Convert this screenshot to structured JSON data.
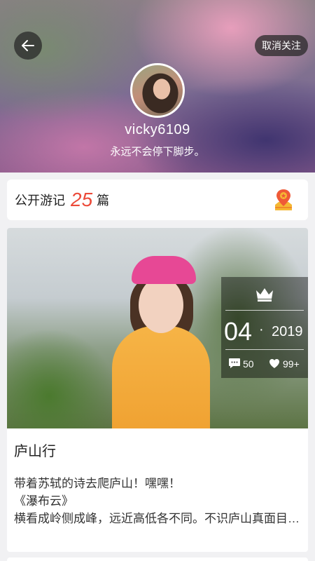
{
  "header": {
    "back_icon": "arrow-left-icon",
    "unfollow_label": "取消关注",
    "username": "vicky6109",
    "motto": "永远不会停下脚步。"
  },
  "stats": {
    "label": "公开游记",
    "count": "25",
    "unit": "篇",
    "count_color": "#ec4b3a",
    "icon": "map-pin-icon"
  },
  "journals": [
    {
      "title": "庐山行",
      "month": "04",
      "separator": "·",
      "year": "2019",
      "comments": "50",
      "likes": "99+",
      "excerpt_lines": [
        "带着苏轼的诗去爬庐山！嘿嘿！",
        "《瀑布云》",
        "横看成岭侧成峰，远近高低各不同。不识庐山真面目，只缘身在此山中。"
      ]
    }
  ]
}
